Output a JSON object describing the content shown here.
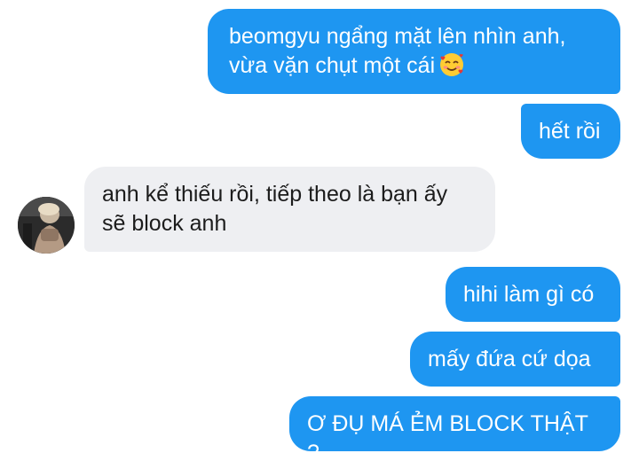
{
  "messages": [
    {
      "side": "sent",
      "lines": [
        "beomgyu ngẩng mặt lên nhìn anh,",
        "vừa vặn chụt một cái"
      ],
      "emoji": "smiling-face-with-hearts-icon"
    },
    {
      "side": "sent",
      "text": "hết rồi"
    },
    {
      "side": "received",
      "lines": [
        "anh kể thiếu rồi, tiếp theo là bạn ấy",
        "sẽ block anh"
      ]
    },
    {
      "side": "sent",
      "text": "hihi làm gì có"
    },
    {
      "side": "sent",
      "text": "mấy đứa cứ dọa"
    },
    {
      "side": "sent",
      "text": "Ơ ĐỤ MÁ ẺM BLOCK THẬT ?"
    }
  ],
  "colors": {
    "sent_bubble": "#1e96f1",
    "received_bubble": "#eeeff2",
    "sent_text": "#ffffff",
    "received_text": "#1c1c1c"
  },
  "avatar": {
    "icon": "contact-avatar"
  }
}
